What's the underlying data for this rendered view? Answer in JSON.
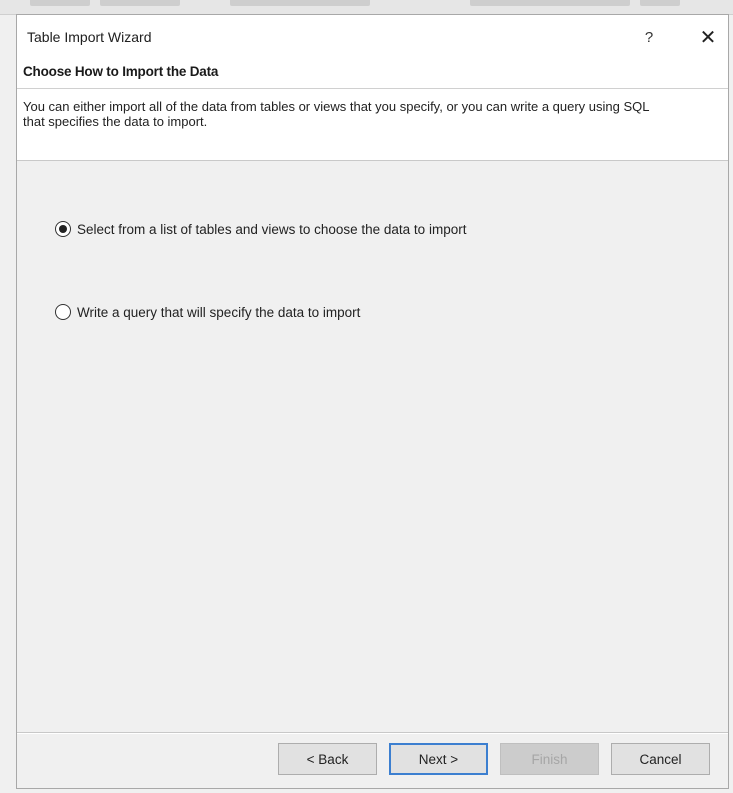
{
  "window": {
    "title": "Table Import Wizard",
    "help_glyph": "?",
    "close_glyph": "✕"
  },
  "header": {
    "section_title": "Choose How to Import the Data",
    "description": "You can either import all of the data from tables or views that you specify, or you can write a query using SQL that specifies the data to import."
  },
  "options": [
    {
      "label": "Select from a list of tables and views to choose the data to import",
      "selected": true
    },
    {
      "label": "Write a query that will specify the data to import",
      "selected": false
    }
  ],
  "buttons": {
    "back": "< Back",
    "next": "Next >",
    "finish": "Finish",
    "cancel": "Cancel"
  },
  "icons": {
    "help": "help-icon",
    "close": "close-icon"
  }
}
